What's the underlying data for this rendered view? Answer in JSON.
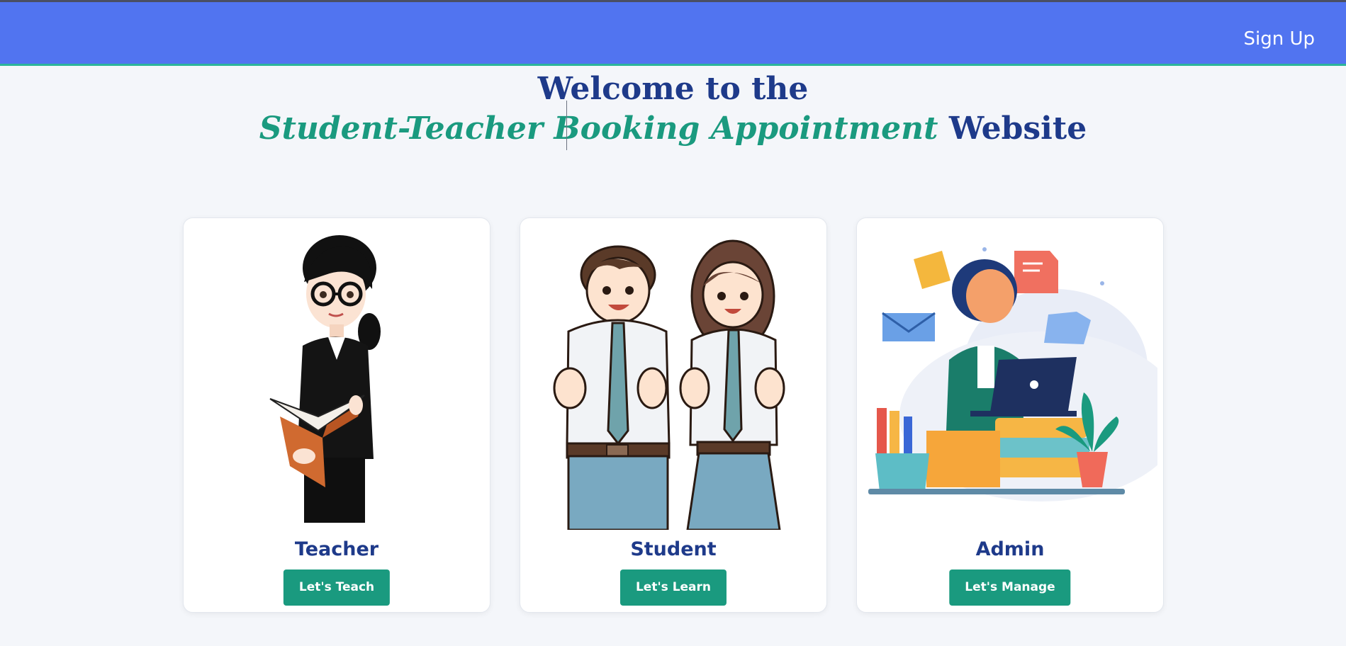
{
  "navbar": {
    "signup_label": "Sign Up",
    "background": "#5174f0",
    "accent_border": "#2bb59a"
  },
  "hero": {
    "line1": "Welcome to the",
    "line2_accent": "Student-Teacher Booking Appointment",
    "line2_tail": "Website",
    "primary_color": "#1e3a8a",
    "accent_color": "#1a9a7f"
  },
  "cards": [
    {
      "title": "Teacher",
      "button_label": "Let's Teach",
      "illustration": "teacher-illustration"
    },
    {
      "title": "Student",
      "button_label": "Let's Learn",
      "illustration": "students-illustration"
    },
    {
      "title": "Admin",
      "button_label": "Let's Manage",
      "illustration": "admin-illustration"
    }
  ]
}
